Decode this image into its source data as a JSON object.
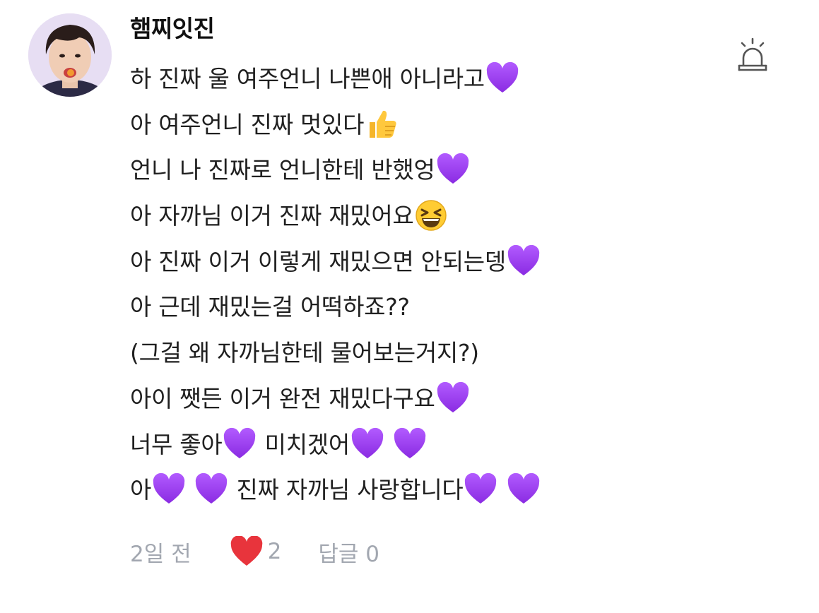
{
  "comment": {
    "username": "햄찌잇진",
    "lines": [
      {
        "text": "하 진짜 울 여주언니 나쁜애 아니라고",
        "emoji": [
          "purple-heart"
        ]
      },
      {
        "text": "아 여주언니 진짜 멋있다",
        "emoji": [
          "thumbs-up"
        ]
      },
      {
        "text": "언니 나 진짜로 언니한테 반했엉",
        "emoji": [
          "purple-heart"
        ]
      },
      {
        "text": "아 자까님 이거 진짜 재밌어요",
        "emoji": [
          "grinning-squinting-face"
        ]
      },
      {
        "text": "아 진짜 이거 이렇게 재밌으면 안되는뎅",
        "emoji": [
          "purple-heart"
        ]
      },
      {
        "text": "아 근데 재밌는걸 어떡하죠??",
        "emoji": []
      },
      {
        "text": "(그걸 왜 자까님한테 물어보는거지?)",
        "emoji": []
      },
      {
        "text": "아이 쨋든 이거 완전 재밌다구요",
        "emoji": [
          "purple-heart"
        ]
      }
    ],
    "line9": {
      "part1": "너무 좋아",
      "part2": "미치겠어"
    },
    "line10": {
      "part1": "아",
      "part2": "진짜 자까님 사랑합니다"
    },
    "meta": {
      "time": "2일 전",
      "like_count": "2",
      "reply_label": "답글 0"
    },
    "colors": {
      "meta_text": "#a2a7b0",
      "heart": "#e8343c",
      "purple_heart": "#9b3df0"
    }
  }
}
